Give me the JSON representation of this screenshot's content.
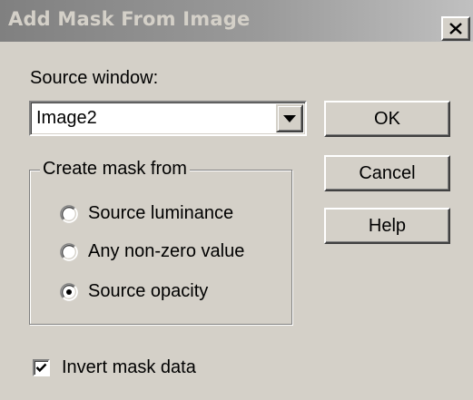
{
  "window": {
    "title": "Add Mask From Image",
    "close_icon": "close-x-icon"
  },
  "source": {
    "label": "Source window:",
    "selected_value": "Image2",
    "dropdown_icon": "chevron-down-icon"
  },
  "buttons": {
    "ok": "OK",
    "cancel": "Cancel",
    "help": "Help"
  },
  "mask_group": {
    "legend": "Create mask from",
    "options": [
      {
        "label": "Source luminance",
        "selected": false
      },
      {
        "label": "Any non-zero value",
        "selected": false
      },
      {
        "label": "Source opacity",
        "selected": true
      }
    ]
  },
  "invert": {
    "label": "Invert mask data",
    "checked": true
  }
}
